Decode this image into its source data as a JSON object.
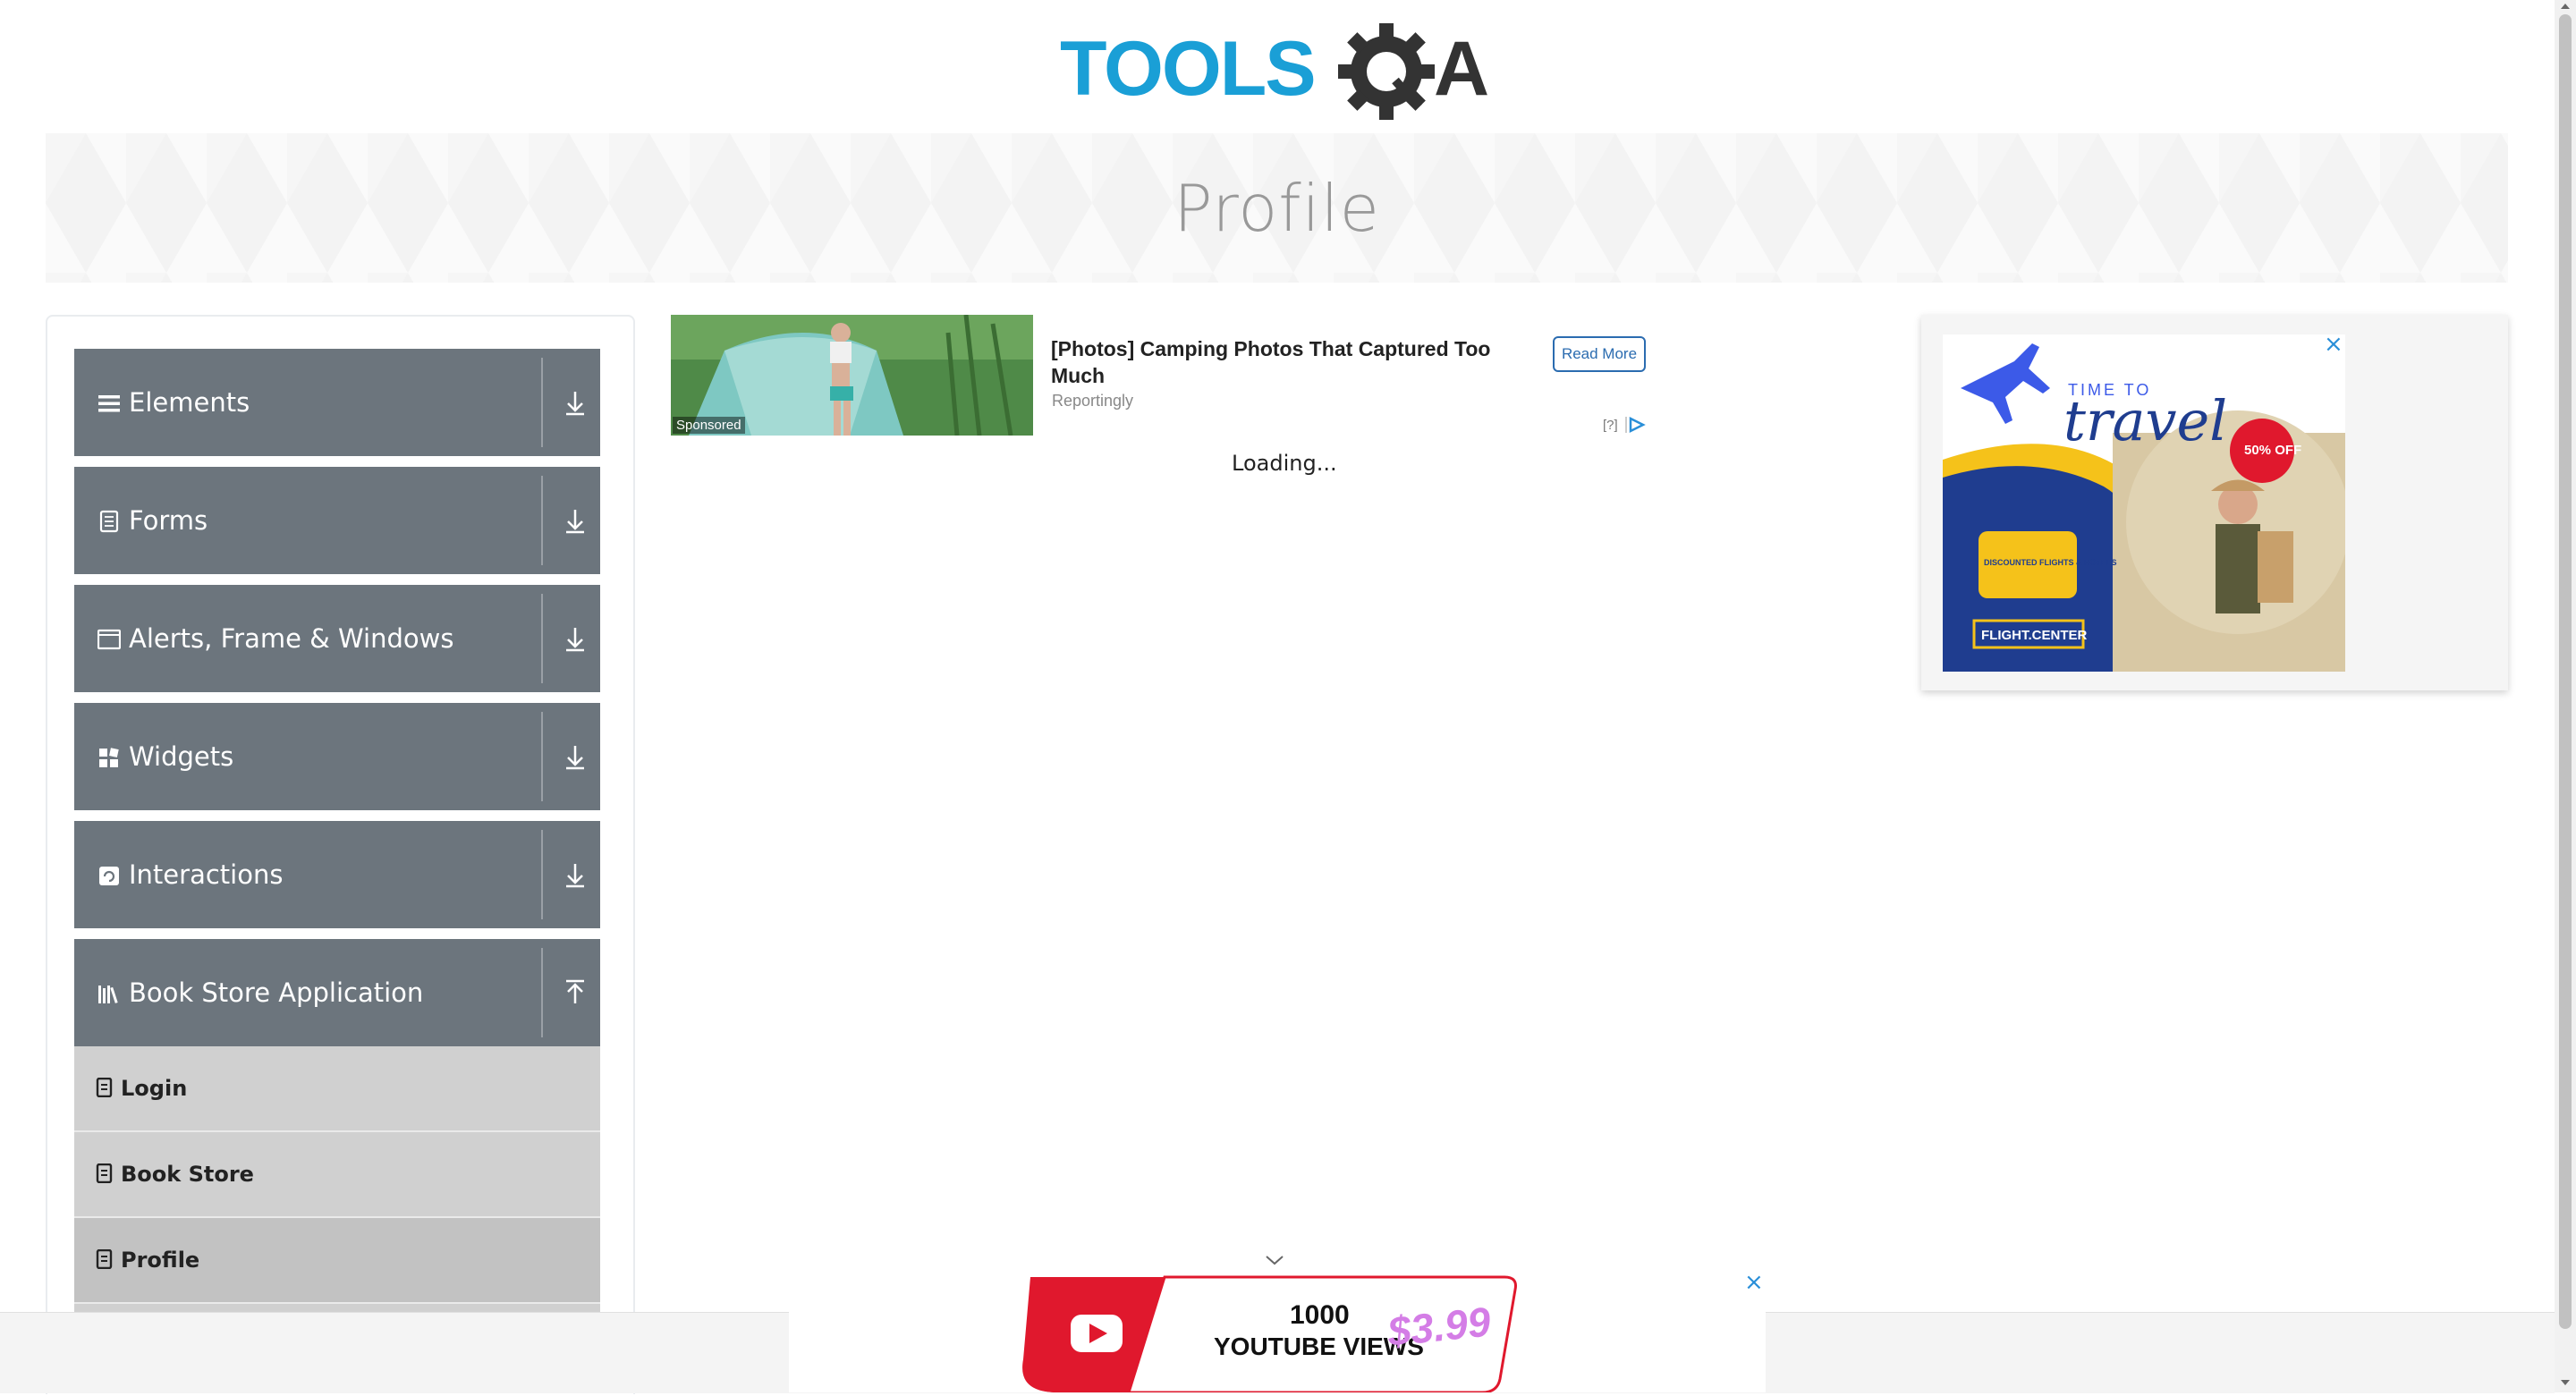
{
  "header": {
    "logo_text_left": "TOOLS",
    "logo_text_right": "A",
    "logo_color_blue": "#1a9fd6",
    "logo_color_dark": "#333333"
  },
  "banner": {
    "title": "Profile"
  },
  "sidebar": {
    "groups": [
      {
        "label": "Elements",
        "icon": "hamburger-icon"
      },
      {
        "label": "Forms",
        "icon": "document-icon"
      },
      {
        "label": "Alerts, Frame & Windows",
        "icon": "window-icon"
      },
      {
        "label": "Widgets",
        "icon": "grid-icon"
      },
      {
        "label": "Interactions",
        "icon": "box-icon"
      },
      {
        "label": "Book Store Application",
        "icon": "books-icon",
        "expanded": true
      }
    ],
    "items": [
      {
        "label": "Login",
        "icon": "list-icon"
      },
      {
        "label": "Book Store",
        "icon": "list-icon"
      },
      {
        "label": "Profile",
        "icon": "list-icon"
      }
    ]
  },
  "ad": {
    "sponsored_label": "Sponsored",
    "title": "[Photos] Camping Photos That Captured Too Much",
    "source": "Reportingly",
    "button_label": "Read More",
    "question_mark": "[?]",
    "loading_text": "Loading..."
  },
  "right_ad": {
    "headline_small": "TIME TO",
    "headline_large": "travel",
    "discount": "50% OFF",
    "box_text": "DISCOUNTED FLIGHTS & HOTELS",
    "brand": "FLIGHT.CENTER",
    "close_symbol": "×"
  },
  "bottom_ad": {
    "line1": "1000",
    "line2": "YOUTUBE VIEWS",
    "price": "$3.99",
    "close_symbol": "×"
  },
  "colors": {
    "sidebar_group_bg": "#6c757d",
    "sidebar_item_bg": "#d0d0d0",
    "accent_blue": "#2a8fd8",
    "ad_red": "#e0182d"
  }
}
